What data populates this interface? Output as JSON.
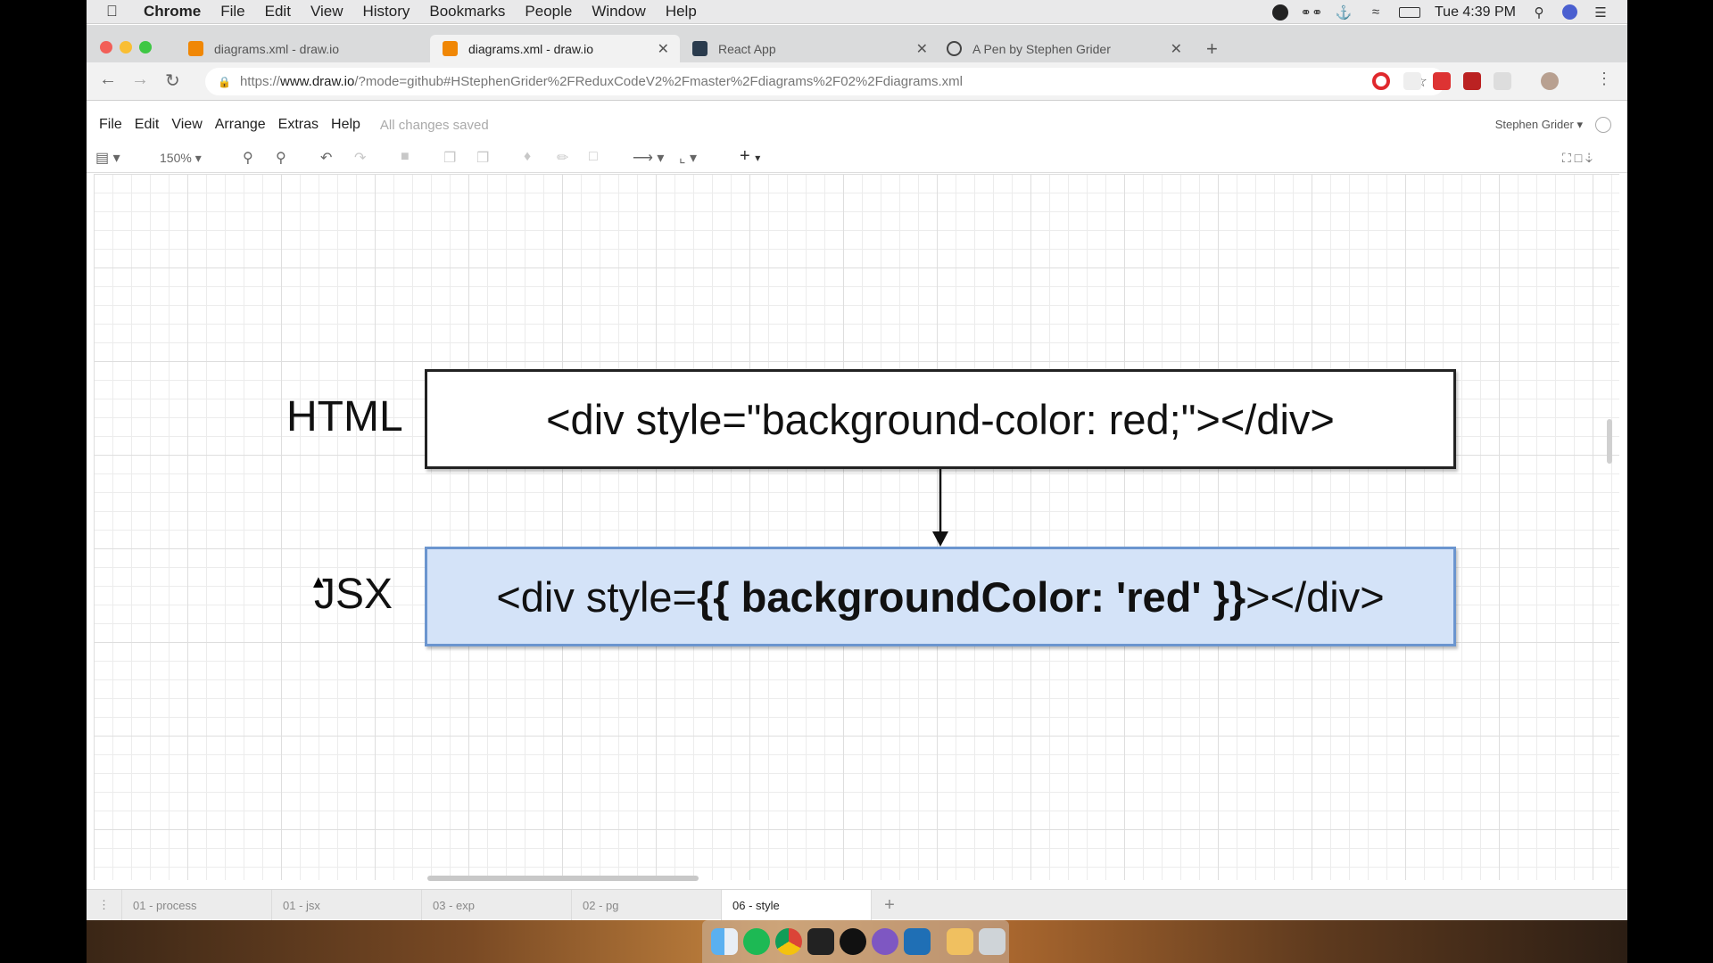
{
  "menubar": {
    "app": "Chrome",
    "items": [
      "File",
      "Edit",
      "View",
      "History",
      "Bookmarks",
      "People",
      "Window",
      "Help"
    ],
    "clock": "Tue 4:39 PM"
  },
  "tabs": [
    {
      "title": "diagrams.xml - draw.io",
      "icon": "drawio-icon"
    },
    {
      "title": "diagrams.xml - draw.io",
      "icon": "drawio-icon"
    },
    {
      "title": "React App",
      "icon": "react-icon"
    },
    {
      "title": "A Pen by Stephen Grider",
      "icon": "codepen-icon"
    }
  ],
  "address": {
    "prefix": "https://",
    "host": "www.draw.io",
    "path": "/?mode=github#HStephenGrider%2FReduxCodeV2%2Fmaster%2Fdiagrams%2F02%2Fdiagrams.xml"
  },
  "drawio": {
    "menu": [
      "File",
      "Edit",
      "View",
      "Arrange",
      "Extras",
      "Help"
    ],
    "status": "All changes saved",
    "user": "Stephen Grider",
    "zoom": "150%"
  },
  "diagram": {
    "html_label": "HTML",
    "jsx_label": "JSX",
    "html_code": "<div style=\"background-color: red;\"></div>",
    "jsx_code_pre": "<div style=",
    "jsx_code_bold": "{{ backgroundColor: 'red' }}",
    "jsx_code_post": "></div>",
    "html_box_fill": "#ffffff",
    "jsx_box_fill": "#d4e3f8",
    "jsx_box_stroke": "#6b95cf"
  },
  "pages": [
    {
      "label": "01 - process",
      "active": false
    },
    {
      "label": "01 - jsx",
      "active": false
    },
    {
      "label": "03 - exp",
      "active": false
    },
    {
      "label": "02 - pg",
      "active": false
    },
    {
      "label": "06 - style",
      "active": true
    }
  ]
}
